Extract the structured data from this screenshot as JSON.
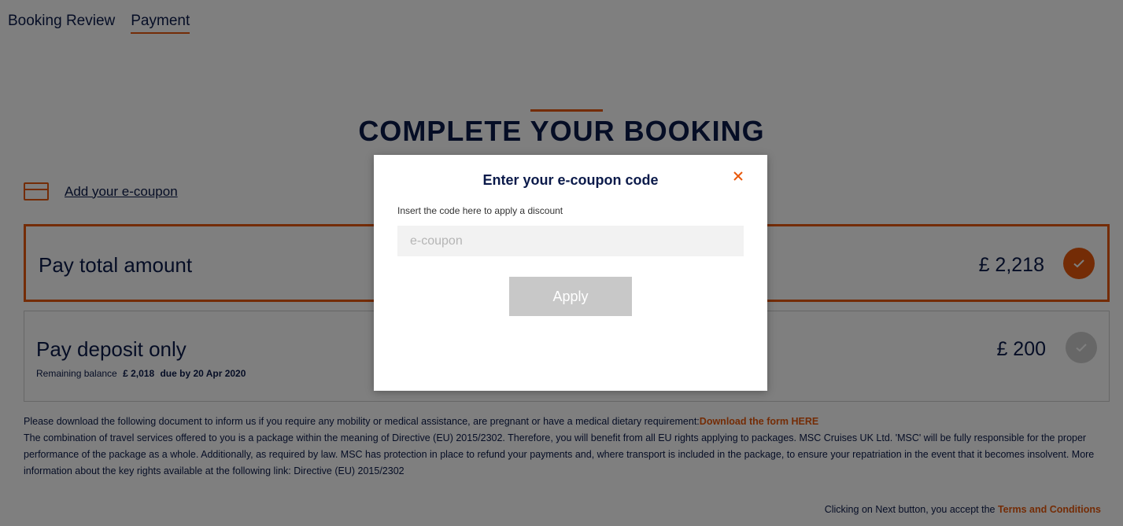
{
  "tabs": [
    {
      "label": "Booking Review"
    },
    {
      "label": "Payment"
    }
  ],
  "page_title": "COMPLETE YOUR BOOKING",
  "coupon_link": "Add your e-coupon",
  "options": {
    "total": {
      "label": "Pay total amount",
      "price": "£ 2,218"
    },
    "deposit": {
      "label": "Pay deposit only",
      "price": "£ 200",
      "remaining_label": "Remaining balance",
      "remaining_amount": "£ 2,018",
      "due": "due by 20 Apr 2020"
    }
  },
  "info": {
    "line1": "Please download the following document to inform us if you require any mobility or medical assistance, are pregnant or have a medical dietary requirement:",
    "download_link": "Download the form HERE",
    "line2": "The combination of travel services offered to you is a package within the meaning of Directive (EU) 2015/2302. Therefore, you will benefit from all EU rights applying to packages. MSC Cruises UK Ltd. 'MSC' will be fully responsible for the proper performance of the package as a whole. Additionally, as required by law. MSC has protection in place to refund your payments and, where transport is included in the package, to ensure your repatriation in the event that it becomes insolvent. More information about the key rights available at the following link: Directive (EU) 2015/2302"
  },
  "footer": {
    "text": "Clicking on Next button, you accept the ",
    "terms_link": "Terms and Conditions"
  },
  "modal": {
    "title": "Enter your e-coupon code",
    "hint": "Insert the code here to apply a discount",
    "input_placeholder": "e-coupon",
    "input_value": "",
    "apply_label": "Apply"
  },
  "colors": {
    "accent": "#e8590c",
    "navy": "#0b1a4a",
    "disabled": "#c8c8c8"
  }
}
